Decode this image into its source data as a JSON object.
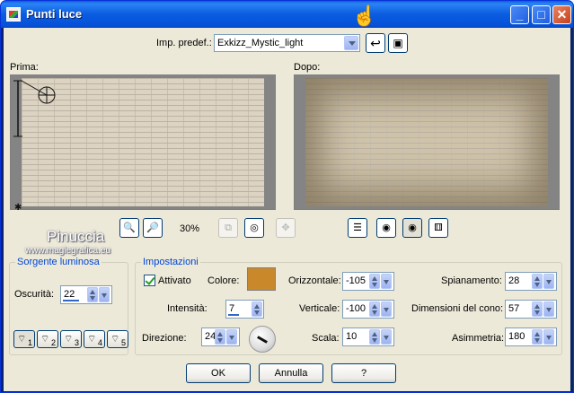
{
  "window": {
    "title": "Punti luce"
  },
  "preset": {
    "label": "Imp. predef.:",
    "value": "Exkizz_Mystic_light"
  },
  "preview": {
    "before_label": "Prima:",
    "after_label": "Dopo:",
    "zoom": "30%"
  },
  "watermark": {
    "line1": "Pinuccia",
    "line2": "www.magiegrafica.eu"
  },
  "source_group": {
    "title": "Sorgente luminosa",
    "darkness_label": "Oscurità:",
    "darkness_value": "22",
    "darkness_fraction": 0.22,
    "light_buttons": [
      "1",
      "2",
      "3",
      "4",
      "5"
    ]
  },
  "settings_group": {
    "title": "Impostazioni",
    "active_label": "Attivato",
    "color_label": "Colore:",
    "color": "#c9892a",
    "intensity_label": "Intensità:",
    "intensity_value": "7",
    "intensity_fraction": 0.07,
    "direction_label": "Direzione:",
    "direction_value": "24",
    "horizontal_label": "Orizzontale:",
    "horizontal_value": "-105",
    "vertical_label": "Verticale:",
    "vertical_value": "-100",
    "scale_label": "Scala:",
    "scale_value": "10",
    "flatten_label": "Spianamento:",
    "flatten_value": "28",
    "cone_label": "Dimensioni del cono:",
    "cone_value": "57",
    "asym_label": "Asimmetria:",
    "asym_value": "180"
  },
  "buttons": {
    "ok": "OK",
    "cancel": "Annulla",
    "help": "?"
  }
}
